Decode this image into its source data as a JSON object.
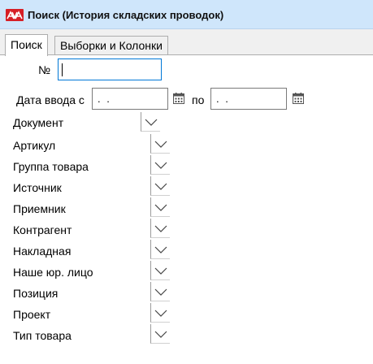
{
  "window": {
    "title": "Поиск (История складских проводок)",
    "icon": "app-logo-icon"
  },
  "tabs": [
    {
      "label": "Поиск",
      "active": true
    },
    {
      "label": "Выборки и Колонки",
      "active": false
    }
  ],
  "form": {
    "number_label": "№",
    "number_value": "",
    "date_label": "Дата ввода с",
    "date_from_value": " .  .",
    "date_to_label": "по",
    "date_to_value": " .  .",
    "calendar_icon": "calendar-icon",
    "fields": [
      {
        "label": "Документ",
        "value": ""
      },
      {
        "label": "Артикул",
        "value": ""
      },
      {
        "label": "Группа товара",
        "value": ""
      },
      {
        "label": "Источник",
        "value": ""
      },
      {
        "label": "Приемник",
        "value": ""
      },
      {
        "label": "Контрагент",
        "value": ""
      },
      {
        "label": "Накладная",
        "value": ""
      },
      {
        "label": "Наше юр. лицо",
        "value": ""
      },
      {
        "label": "Позиция",
        "value": ""
      },
      {
        "label": "Проект",
        "value": ""
      },
      {
        "label": "Тип товара",
        "value": ""
      }
    ]
  },
  "colors": {
    "titlebar": "#cfe6fb",
    "logo": "#d61f26",
    "focus_border": "#0078d7"
  }
}
